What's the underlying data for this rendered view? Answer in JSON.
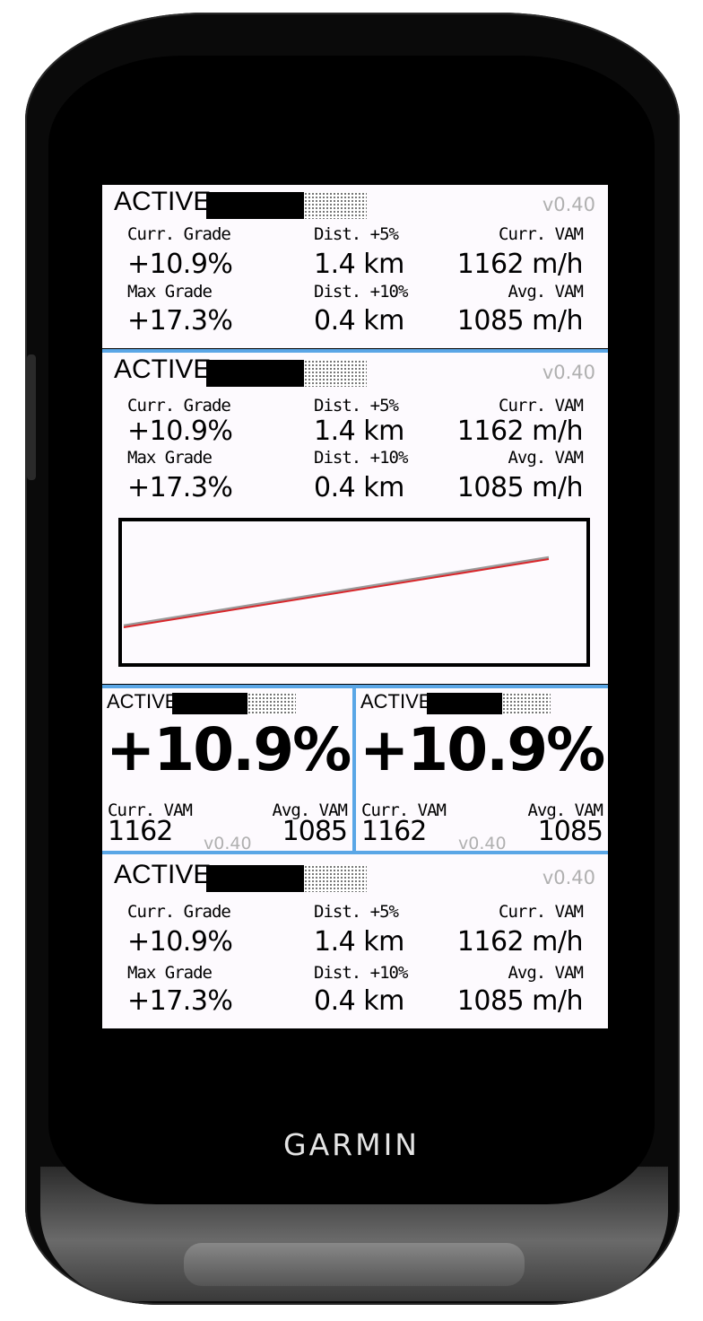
{
  "device": {
    "brand": "GARMIN"
  },
  "status": {
    "label": "ACTIVE",
    "version": "v0.40"
  },
  "labels": {
    "curr_grade": "Curr. Grade",
    "max_grade": "Max Grade",
    "dist_5": "Dist. +5%",
    "dist_10": "Dist. +10%",
    "curr_vam": "Curr. VAM",
    "avg_vam": "Avg. VAM"
  },
  "values": {
    "curr_grade": "+10.9%",
    "max_grade": "+17.3%",
    "dist_5": "1.4 km",
    "dist_10": "0.4 km",
    "curr_vam": "1162 m/h",
    "avg_vam": "1085 m/h",
    "curr_vam_short": "1162",
    "avg_vam_short": "1085"
  },
  "progress": {
    "active_fraction": 0.61
  },
  "colors": {
    "divider": "#5aa6e6",
    "profile_line": "#d9262b",
    "profile_shadow": "#9a9a9a"
  },
  "chart_data": {
    "type": "line",
    "title": "",
    "xlabel": "",
    "ylabel": "",
    "grid": false,
    "series": [
      {
        "x": [
          0,
          1
        ],
        "y": [
          0,
          1
        ]
      }
    ]
  }
}
